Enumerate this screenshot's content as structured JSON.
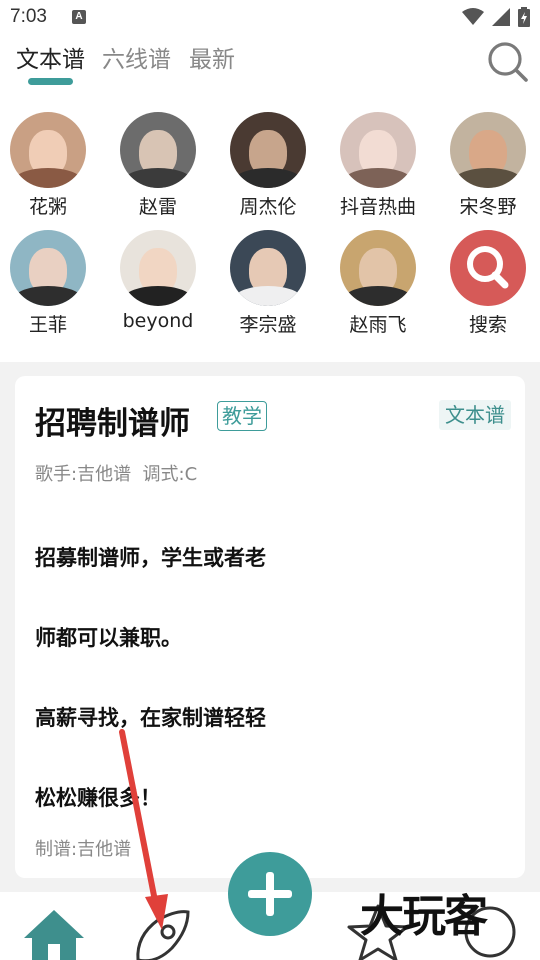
{
  "status_bar": {
    "time": "7:03",
    "indicator": "A"
  },
  "tabs": [
    {
      "label": "文本谱",
      "active": true
    },
    {
      "label": "六线谱",
      "active": false
    },
    {
      "label": "最新",
      "active": false
    }
  ],
  "artists": [
    {
      "name": "花粥"
    },
    {
      "name": "赵雷"
    },
    {
      "name": "周杰伦"
    },
    {
      "name": "抖音热曲"
    },
    {
      "name": "宋冬野"
    },
    {
      "name": "王菲"
    },
    {
      "name": "beyond"
    },
    {
      "name": "李宗盛"
    },
    {
      "name": "赵雨飞"
    },
    {
      "name": "搜索"
    }
  ],
  "card": {
    "title": "招聘制谱师",
    "badge": "教学",
    "type": "文本谱",
    "meta": "歌手:吉他谱  调式:C",
    "lines": [
      "招募制谱师，学生或者老",
      "师都可以兼职。",
      "高薪寻找，在家制谱轻轻",
      "松松赚很多！"
    ],
    "author": "制谱:吉他谱"
  },
  "watermark": "大玩客",
  "colors": {
    "accent": "#3e9c9a",
    "search_red": "#d65a58",
    "arrow": "#e0403a"
  }
}
